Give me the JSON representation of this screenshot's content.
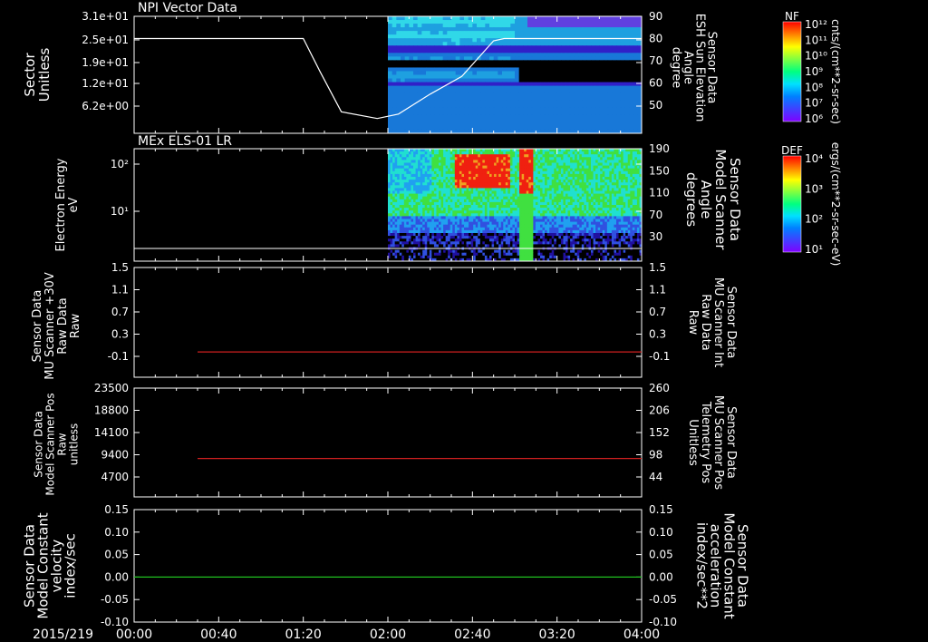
{
  "date_label": "2015/219",
  "time_ticks": [
    "00:00",
    "00:40",
    "01:20",
    "02:00",
    "02:40",
    "03:20",
    "04:00"
  ],
  "colorbars": [
    {
      "id": "nf",
      "label": "NF",
      "units": "cnts/(cm**2-sr-sec)",
      "ticks": [
        "10¹²",
        "10¹¹",
        "10¹⁰",
        "10⁹",
        "10⁸",
        "10⁷",
        "10⁶"
      ]
    },
    {
      "id": "def",
      "label": "DEF",
      "units": "ergs/(cm**2-sr-sec-eV)",
      "ticks": [
        "10⁴",
        "10³",
        "10²",
        "10¹"
      ]
    }
  ],
  "colors": {
    "axis": "#ffffff",
    "red_line": "#d02020",
    "green_line": "#20c020",
    "red_text": "#ff2020",
    "green_text": "#20e020"
  },
  "chart_data": [
    {
      "id": "panel1",
      "type": "heatmap",
      "title": "NPI Vector Data",
      "ylabel_left": [
        "Sector",
        "Unitless"
      ],
      "ylabel_right": [
        "Sensor Data",
        "ESH Sun Elevation",
        "Angle",
        "degree"
      ],
      "yticks_left": [
        "3.1e+01",
        "2.5e+01",
        "1.9e+01",
        "1.2e+01",
        "6.2e+00"
      ],
      "yticks_right": [
        "90",
        "80",
        "70",
        "60",
        "50"
      ],
      "yrange_right": [
        40,
        90
      ],
      "line_series": {
        "name": "Sun Elevation",
        "x": [
          "00:00",
          "01:20",
          "01:28",
          "01:38",
          "01:55",
          "02:05",
          "02:20",
          "02:35",
          "02:50",
          "02:55",
          "04:00"
        ],
        "y": [
          80,
          80,
          65,
          47,
          44,
          46,
          55,
          63,
          79,
          80,
          80
        ]
      }
    },
    {
      "id": "panel2",
      "type": "heatmap",
      "title": "MEx ELS-01 LR",
      "ylabel_left": [
        "Electron Energy",
        "eV"
      ],
      "ylabel_right": [
        "Sensor Data",
        "Model Scanner",
        "Angle",
        "degrees"
      ],
      "yticks_left": [
        "10²",
        "10¹"
      ],
      "yticks_right": [
        "190",
        "150",
        "110",
        "70",
        "30"
      ],
      "yrange_right": [
        0,
        190
      ],
      "line_series": {
        "name": "Scanner Angle",
        "x": [
          "00:00",
          "04:00"
        ],
        "y": [
          10,
          10
        ]
      }
    },
    {
      "id": "panel3",
      "type": "line",
      "ylabel_left": [
        "Sensor Data",
        "MU Scanner +30V",
        "Raw Data",
        "Raw"
      ],
      "ylabel_right": [
        "Sensor Data",
        "MU Scanner Int",
        "Raw Data",
        "Raw"
      ],
      "yticks_left": [
        "1.5",
        "1.1",
        "0.7",
        "0.3",
        "-0.1"
      ],
      "yticks_right": [
        "1.5",
        "1.1",
        "0.7",
        "0.3",
        "-0.1"
      ],
      "ylim": [
        -0.3,
        1.5
      ],
      "series": [
        {
          "x": [
            "00:30",
            "04:00"
          ],
          "y": [
            -0.02,
            -0.02
          ]
        }
      ]
    },
    {
      "id": "panel4",
      "type": "line",
      "ylabel_left": [
        "Sensor Data",
        "Model Scanner Pos",
        "Raw",
        "unitless"
      ],
      "ylabel_right": [
        "Sensor Data",
        "MU Scanner Pos",
        "Telemetry Pos",
        "Unitless"
      ],
      "yticks_left": [
        "23500",
        "18800",
        "14100",
        "9400",
        "4700"
      ],
      "yticks_right": [
        "260",
        "206",
        "152",
        "98",
        "44"
      ],
      "ylim": [
        0,
        23500
      ],
      "series": [
        {
          "x": [
            "00:30",
            "04:00"
          ],
          "y": [
            8300,
            8300
          ]
        }
      ]
    },
    {
      "id": "panel5",
      "type": "line",
      "ylabel_left": [
        "Sensor Data",
        "Model Constant",
        "velocity",
        "index/sec"
      ],
      "ylabel_right": [
        "Sensor Data",
        "Model Constant",
        "acceleration",
        "index/sec**2"
      ],
      "yticks_left": [
        "0.15",
        "0.10",
        "0.05",
        "0.00",
        "-0.05",
        "-0.10"
      ],
      "yticks_right": [
        "0.15",
        "0.10",
        "0.05",
        "0.00",
        "-0.05",
        "-0.10"
      ],
      "ylim": [
        -0.1,
        0.15
      ],
      "series": [
        {
          "x": [
            "00:00",
            "04:00"
          ],
          "y": [
            0,
            0
          ]
        }
      ]
    }
  ]
}
